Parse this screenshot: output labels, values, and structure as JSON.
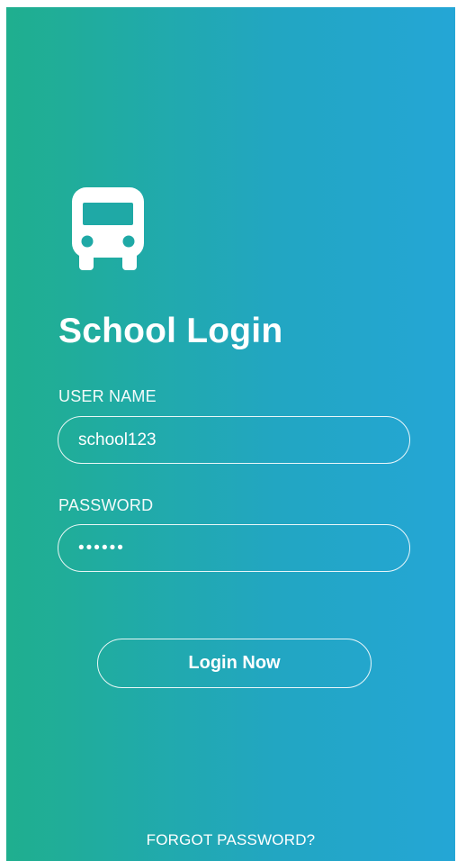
{
  "login": {
    "title": "School Login",
    "username_label": "USER NAME",
    "username_value": "school123",
    "password_label": "PASSWORD",
    "password_value": "••••••",
    "login_button": "Login Now",
    "forgot_password": "FORGOT PASSWORD?"
  },
  "icons": {
    "app": "bus-icon"
  },
  "colors": {
    "gradient_start": "#1faf8e",
    "gradient_end": "#24a6d6",
    "text": "#ffffff"
  }
}
